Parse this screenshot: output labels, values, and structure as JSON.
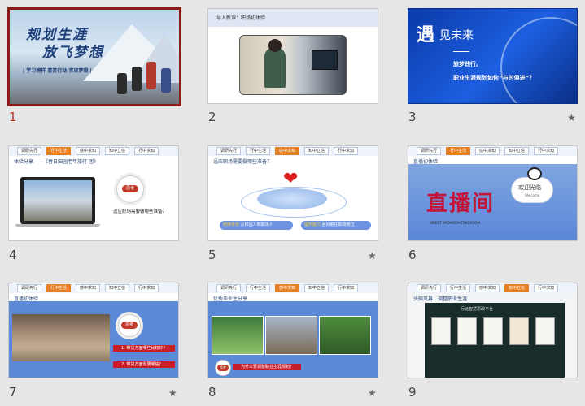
{
  "slides": [
    {
      "num": "1",
      "selected": true,
      "starred": false,
      "title_line1": "规划生涯",
      "title_line2": "放飞梦想",
      "tagline": "| 学习榜样    喜笑行动    实现梦想 |"
    },
    {
      "num": "2",
      "selected": false,
      "starred": false,
      "header": "导入新课：职场初体验"
    },
    {
      "num": "3",
      "selected": false,
      "starred": true,
      "big_char": "遇",
      "rest": "见未来",
      "line1": "旅梦践行。",
      "line2": "职业生涯规划如何“与时俱进”？"
    },
    {
      "num": "4",
      "selected": false,
      "starred": false,
      "tabs": [
        "调研先行",
        "行中生活",
        "感中求知",
        "知中立信",
        "行中求知"
      ],
      "active_tab": "行中生活",
      "subhead": "体验分享——《春日田园老年旅行 团》",
      "badge": "思考",
      "question": "适应职场需要做哪些准备？"
    },
    {
      "num": "5",
      "selected": false,
      "starred": true,
      "tabs": [
        "调研先行",
        "行中生活",
        "感中求知",
        "知中立信",
        "行中求知"
      ],
      "active_tab": "感中求知",
      "subhead": "适应职场需要做哪些准备？",
      "pill1_tag": "转换身份",
      "pill1_text": "从校园人到职场人",
      "pill2_tag": "提升能力",
      "pill2_text": "更好胜任职场岗位"
    },
    {
      "num": "6",
      "selected": false,
      "starred": false,
      "tabs": [
        "调研先行",
        "行中生活",
        "感中求知",
        "知中立信",
        "行中求知"
      ],
      "active_tab": "行中生活",
      "subhead": "直播初体验",
      "live": "直播间",
      "live_sub": "DIRECT BROADCASTING ROOM",
      "welcome": "欢迎光临",
      "welcome_en": "Welcome"
    },
    {
      "num": "7",
      "selected": false,
      "starred": true,
      "tabs": [
        "调研先行",
        "行中生活",
        "感中求知",
        "知中立信",
        "行中求知"
      ],
      "active_tab": "行中生活",
      "subhead": "直播初体验",
      "badge": "思考",
      "q1": "1. 带货方面哪些比较好？",
      "q2": "2. 带货方面需要哪些？"
    },
    {
      "num": "8",
      "selected": false,
      "starred": true,
      "tabs": [
        "调研先行",
        "行中生活",
        "感中求知",
        "知中立信",
        "行中求知"
      ],
      "active_tab": "感中求知",
      "subhead": "优秀毕业生分享",
      "badge": "思考",
      "question": "为什么要调整职业生涯规划？"
    },
    {
      "num": "9",
      "selected": false,
      "starred": false,
      "tabs": [
        "调研先行",
        "行中生活",
        "感中求知",
        "知中立信",
        "行中求知"
      ],
      "active_tab": "知中立信",
      "subhead": "头脑风暴：调整职业生涯",
      "dark_title": "行远智慧思政平台"
    }
  ],
  "colors": {
    "selected_border": "#8b1a1a",
    "active_tab": "#e67e22",
    "accent_red": "#c81e2a"
  },
  "icons": {
    "star": "star-icon",
    "heart": "heart-icon"
  }
}
